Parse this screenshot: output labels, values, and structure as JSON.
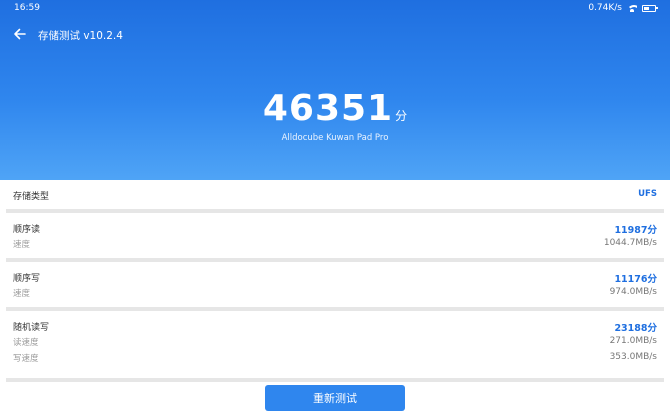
{
  "status_bar": {
    "time": "16:59",
    "net_speed": "0.74K/s"
  },
  "header": {
    "title": "存储测试 v10.2.4",
    "score": "46351",
    "score_unit": "分",
    "device": "Alldocube Kuwan Pad Pro"
  },
  "storage_type": {
    "label": "存储类型",
    "value": "UFS"
  },
  "sequential_read": {
    "label": "顺序读",
    "score": "11987分",
    "speed_label": "速度",
    "speed": "1044.7MB/s"
  },
  "sequential_write": {
    "label": "顺序写",
    "score": "11176分",
    "speed_label": "速度",
    "speed": "974.0MB/s"
  },
  "random_rw": {
    "label": "随机读写",
    "score": "23188分",
    "read_label": "读速度",
    "read_speed": "271.0MB/s",
    "write_label": "写速度",
    "write_speed": "353.0MB/s"
  },
  "retest_button": "重新测试",
  "colors": {
    "accent": "#1f6fe0",
    "button": "#2f86ee",
    "divider": "#e6e6e6"
  },
  "icons": [
    "back-arrow-icon",
    "wifi-icon",
    "battery-icon"
  ]
}
